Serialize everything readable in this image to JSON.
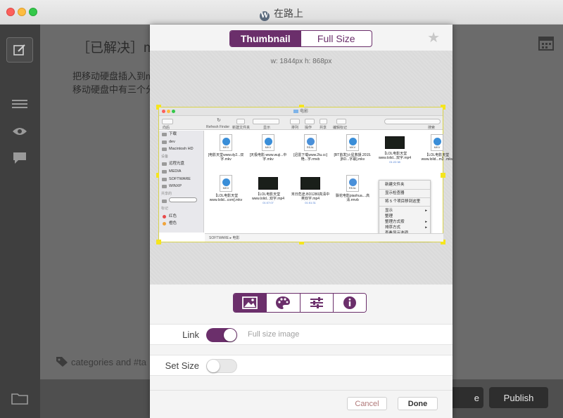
{
  "window": {
    "title": "在路上"
  },
  "editor": {
    "post_title": "［已解决］m",
    "body_line1": "把移动硬盘插入到m",
    "body_line2": "移动硬盘中有三个分",
    "tags_placeholder": "categories and #ta",
    "preview_label": "e",
    "publish_label": "Publish"
  },
  "modal": {
    "tabs": [
      {
        "label": "Thumbnail"
      },
      {
        "label": "Full Size"
      }
    ],
    "dimensions": "w: 1844px h: 868px",
    "link_label": "Link",
    "link_hint": "Full size image",
    "link_on": true,
    "set_size_label": "Set Size",
    "set_size_on": false,
    "cancel_label": "Cancel",
    "done_label": "Done",
    "icon_tabs": [
      "image-icon",
      "palette-icon",
      "sliders-icon",
      "info-icon"
    ],
    "accent": "#6b2f6b"
  },
  "finder": {
    "title": "电影",
    "toolbar": {
      "back": "向后",
      "refresh": "Refresh Finder",
      "newfolder": "新建文件夹",
      "view": "显示",
      "arrange": "排列",
      "action": "操作",
      "share": "共享",
      "tags": "编辑标记",
      "search": "搜索"
    },
    "sidebar": [
      {
        "label": "下载",
        "hdr": false,
        "dot": ""
      },
      {
        "label": "dev",
        "hdr": false,
        "dot": ""
      },
      {
        "label": "Macintosh HD",
        "hdr": false,
        "dot": ""
      },
      {
        "label": "设备",
        "hdr": true,
        "dot": ""
      },
      {
        "label": "远程光盘",
        "hdr": false,
        "dot": ""
      },
      {
        "label": "MEDIA",
        "hdr": false,
        "dot": ""
      },
      {
        "label": "SOFTWARE",
        "hdr": false,
        "dot": ""
      },
      {
        "label": "WINXP",
        "hdr": false,
        "dot": ""
      },
      {
        "label": "共享的",
        "hdr": true,
        "dot": ""
      },
      {
        "label": "",
        "hdr": false,
        "dot": ""
      },
      {
        "label": "标记",
        "hdr": true,
        "dot": ""
      },
      {
        "label": "红色",
        "hdr": false,
        "dot": "#e84b4b"
      },
      {
        "label": "橙色",
        "hdr": false,
        "dot": "#f0a33a"
      }
    ],
    "files": [
      {
        "type": "MKV",
        "name": "[电影天堂www.dy2...双字.mkv",
        "sub": ""
      },
      {
        "type": "MKV",
        "name": "[天极电影-www.wuji...中字.mkv",
        "sub": ""
      },
      {
        "type": "REAL",
        "name": "[迅雷下载www.2tu.cc]艳...字.rmvb",
        "sub": ""
      },
      {
        "type": "MKV",
        "name": "[BT首发]火星救援.2015.[BD...字幕].mkv",
        "sub": ""
      },
      {
        "type": "VID",
        "name": "【LOL电影天堂www.lolid...双字.mp4",
        "sub": "01:22:38"
      },
      {
        "type": "MKV",
        "name": "【LOL电影天堂www.lolid...m】.mkv",
        "sub": ""
      },
      {
        "type": "MKV",
        "name": "【LOL电影天堂www.lolid...com].mkv",
        "sub": ""
      },
      {
        "type": "VID",
        "name": "【LOL电影天堂www.lolid...双字.mp4",
        "sub": "01:07:07"
      },
      {
        "type": "VID",
        "name": "末日危途.BD1280高清中英双字.mp4",
        "sub": "01:51:31"
      },
      {
        "type": "REAL",
        "name": "飘花电影piaohua....高清.rmvb",
        "sub": ""
      }
    ],
    "menu": [
      {
        "label": "新建文件夹",
        "arrow": false,
        "sep": false
      },
      {
        "label": "",
        "arrow": false,
        "sep": true
      },
      {
        "label": "显示检查器",
        "arrow": false,
        "sep": false
      },
      {
        "label": "",
        "arrow": false,
        "sep": true
      },
      {
        "label": "将 5 个项目移到这里",
        "arrow": false,
        "sep": false
      },
      {
        "label": "",
        "arrow": false,
        "sep": true
      },
      {
        "label": "显示",
        "arrow": true,
        "sep": false
      },
      {
        "label": "整理",
        "arrow": false,
        "sep": false
      },
      {
        "label": "整理方式按",
        "arrow": true,
        "sep": false
      },
      {
        "label": "排序方式",
        "arrow": true,
        "sep": false
      },
      {
        "label": "查看显示选项",
        "arrow": false,
        "sep": false
      }
    ],
    "path": "SOFTWARE ▸ 电影"
  }
}
